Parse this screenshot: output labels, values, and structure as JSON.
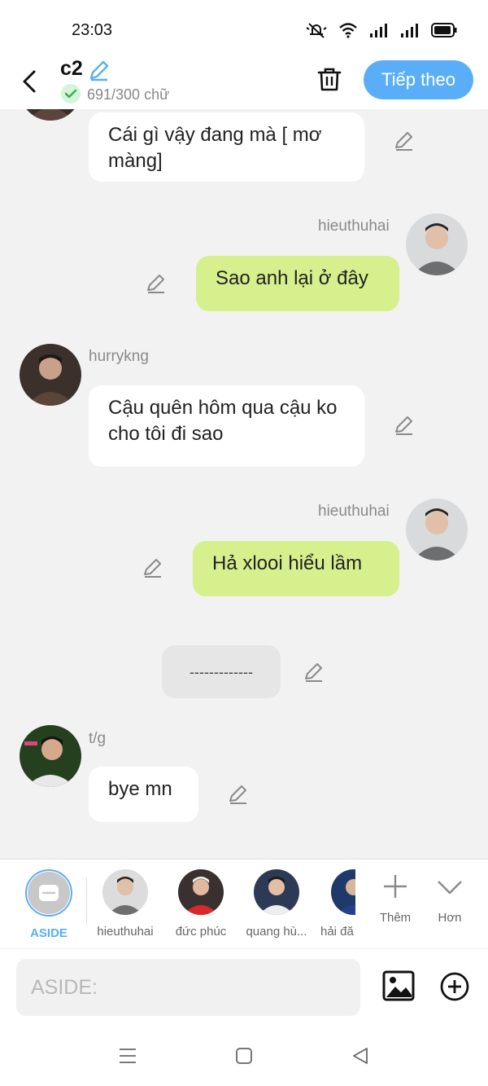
{
  "status_bar": {
    "time": "23:03"
  },
  "header": {
    "title": "c2",
    "word_count": "691/300 chữ",
    "next_label": "Tiếp theo"
  },
  "messages": [
    {
      "id": "m1",
      "side": "left",
      "text": "Cái gì vậy đang mà [ mơ màng]"
    },
    {
      "id": "m2",
      "side": "right",
      "sender": "hieuthuhai",
      "text": "Sao anh lại ở đây"
    },
    {
      "id": "m3",
      "side": "left",
      "sender": "hurrykng",
      "text": "Cậu quên hôm qua cậu ko cho tôi đi sao"
    },
    {
      "id": "m4",
      "side": "right",
      "sender": "hieuthuhai",
      "text": "Hả xlooi hiểu lầm"
    },
    {
      "id": "m5",
      "side": "center",
      "text": "-------------"
    },
    {
      "id": "m6",
      "side": "left",
      "sender": "t/g",
      "text": "bye mn"
    }
  ],
  "characters": [
    {
      "label": "ASIDE",
      "selected": true
    },
    {
      "label": "hieuthuhai"
    },
    {
      "label": "đức phúc"
    },
    {
      "label": "quang hù..."
    },
    {
      "label": "hải đă"
    }
  ],
  "tools": {
    "more_label": "Thêm",
    "less_label": "Hơn"
  },
  "input": {
    "placeholder": "ASIDE:"
  },
  "colors": {
    "accent": "#5aaef7",
    "green_bubble": "#d6f08e",
    "white_bubble": "#ffffff"
  }
}
